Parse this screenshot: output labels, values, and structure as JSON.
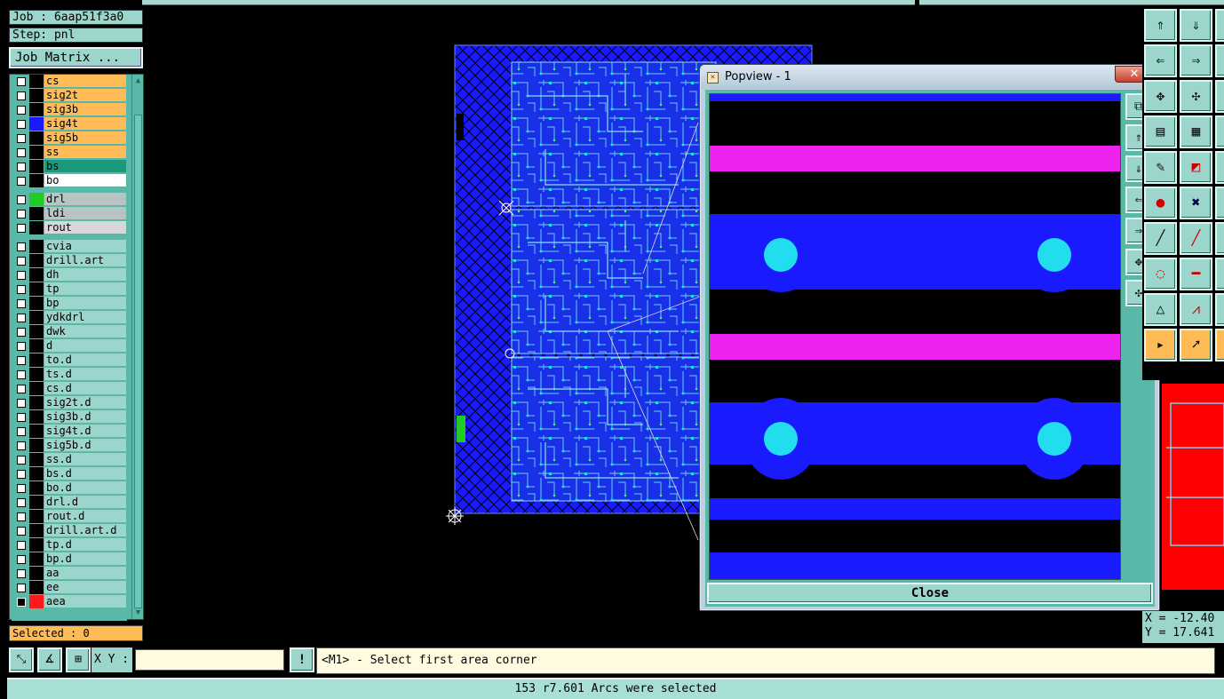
{
  "job": {
    "label": "Job : 6aap51f3a0",
    "step": "Step: pnl"
  },
  "job_matrix_button": "Job Matrix ...",
  "layers_group1": [
    {
      "name": "cs",
      "style": "orange",
      "color": "#000000",
      "checked": false
    },
    {
      "name": "sig2t",
      "style": "orange",
      "color": "#000000",
      "checked": false
    },
    {
      "name": "sig3b",
      "style": "orange",
      "color": "#000000",
      "checked": false
    },
    {
      "name": "sig4t",
      "style": "orange",
      "color": "#1a1aff",
      "checked": false
    },
    {
      "name": "sig5b",
      "style": "orange",
      "color": "#000000",
      "checked": false
    },
    {
      "name": "ss",
      "style": "orange",
      "color": "#000000",
      "checked": false
    },
    {
      "name": "bs",
      "style": "teal",
      "color": "#000000",
      "checked": false
    },
    {
      "name": "bo",
      "style": "white",
      "color": "#000000",
      "checked": false
    }
  ],
  "layers_group2": [
    {
      "name": "drl",
      "style": "grey",
      "color": "#22cc22",
      "checked": false
    },
    {
      "name": "ldi",
      "style": "grey",
      "color": "#000000",
      "checked": false
    },
    {
      "name": "rout",
      "style": "lgrey",
      "color": "#000000",
      "checked": false
    }
  ],
  "layers_group3": [
    {
      "name": "cvia",
      "style": "plain",
      "color": "#000000",
      "checked": false
    },
    {
      "name": "drill.art",
      "style": "plain",
      "color": "#000000",
      "checked": false
    },
    {
      "name": "dh",
      "style": "plain",
      "color": "#000000",
      "checked": false
    },
    {
      "name": "tp",
      "style": "plain",
      "color": "#000000",
      "checked": false
    },
    {
      "name": "bp",
      "style": "plain",
      "color": "#000000",
      "checked": false
    },
    {
      "name": "ydkdrl",
      "style": "plain",
      "color": "#000000",
      "checked": false
    },
    {
      "name": "dwk",
      "style": "plain",
      "color": "#000000",
      "checked": false
    },
    {
      "name": "d",
      "style": "plain",
      "color": "#000000",
      "checked": false
    },
    {
      "name": "to.d",
      "style": "plain",
      "color": "#000000",
      "checked": false
    },
    {
      "name": "ts.d",
      "style": "plain",
      "color": "#000000",
      "checked": false
    },
    {
      "name": "cs.d",
      "style": "plain",
      "color": "#000000",
      "checked": false
    },
    {
      "name": "sig2t.d",
      "style": "plain",
      "color": "#000000",
      "checked": false
    },
    {
      "name": "sig3b.d",
      "style": "plain",
      "color": "#000000",
      "checked": false
    },
    {
      "name": "sig4t.d",
      "style": "plain",
      "color": "#000000",
      "checked": false
    },
    {
      "name": "sig5b.d",
      "style": "plain",
      "color": "#000000",
      "checked": false
    },
    {
      "name": "ss.d",
      "style": "plain",
      "color": "#000000",
      "checked": false
    },
    {
      "name": "bs.d",
      "style": "plain",
      "color": "#000000",
      "checked": false
    },
    {
      "name": "bo.d",
      "style": "plain",
      "color": "#000000",
      "checked": false
    },
    {
      "name": "drl.d",
      "style": "plain",
      "color": "#000000",
      "checked": false
    },
    {
      "name": "rout.d",
      "style": "plain",
      "color": "#000000",
      "checked": false
    },
    {
      "name": "drill.art.d",
      "style": "plain",
      "color": "#000000",
      "checked": false
    },
    {
      "name": "tp.d",
      "style": "plain",
      "color": "#000000",
      "checked": false
    },
    {
      "name": "bp.d",
      "style": "plain",
      "color": "#000000",
      "checked": false
    },
    {
      "name": "aa",
      "style": "plain",
      "color": "#000000",
      "checked": false
    },
    {
      "name": "ee",
      "style": "plain",
      "color": "#000000",
      "checked": false
    },
    {
      "name": "aea",
      "style": "plain",
      "color": "#ff1a1a",
      "checked": true
    }
  ],
  "selected": "Selected : 0",
  "popview": {
    "title": "Popview - 1",
    "close_x": "✕",
    "close_button": "Close",
    "colors": {
      "trace": "#1a1aff",
      "pad": "#22ddee",
      "magenta": "#ee22ee",
      "bg": "#000000"
    }
  },
  "coords": {
    "x": "X = -12.40",
    "y": "Y = 17.641"
  },
  "command": {
    "xy_label": "X Y :",
    "xy_value": "",
    "exclaim": "!",
    "prompt": "<M1> - Select first area corner"
  },
  "status": "153 r7.601 Arcs were selected",
  "colors": {
    "panel": "#9cd5cc",
    "panel_dark": "#5ab8a8",
    "highlight": "#ffbb55",
    "board": "#1a1aff"
  },
  "icons": [
    "zoom-area-icon",
    "measure-icon",
    "grid-icon",
    "fit-icon",
    "pan-up-icon",
    "pan-down-icon",
    "pan-left-icon",
    "pan-right-icon"
  ]
}
